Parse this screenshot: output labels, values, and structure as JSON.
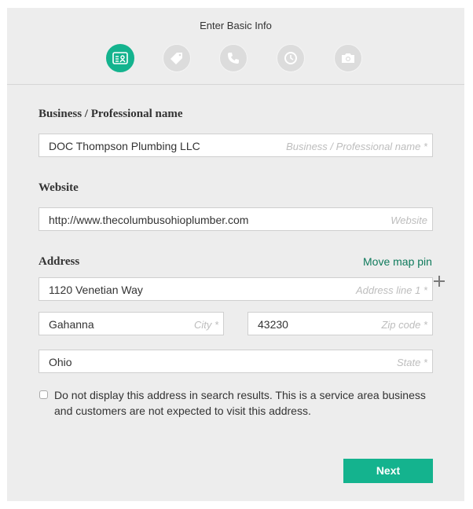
{
  "header": {
    "title": "Enter Basic Info",
    "steps": [
      {
        "icon": "id-card-icon",
        "active": true
      },
      {
        "icon": "tag-icon",
        "active": false
      },
      {
        "icon": "phone-icon",
        "active": false
      },
      {
        "icon": "clock-icon",
        "active": false
      },
      {
        "icon": "camera-icon",
        "active": false
      }
    ]
  },
  "form": {
    "business_name": {
      "label": "Business / Professional name",
      "value": "DOC Thompson Plumbing LLC",
      "placeholder": "Business / Professional name *"
    },
    "website": {
      "label": "Website",
      "value": "http://www.thecolumbusohioplumber.com",
      "placeholder": "Website"
    },
    "address": {
      "label": "Address",
      "move_pin_link": "Move map pin",
      "line1": {
        "value": "1120 Venetian Way",
        "placeholder": "Address line 1 *"
      },
      "city": {
        "value": "Gahanna",
        "placeholder": "City *"
      },
      "zip": {
        "value": "43230",
        "placeholder": "Zip code *"
      },
      "state": {
        "value": "Ohio",
        "placeholder": "State *"
      }
    },
    "hide_address": {
      "checked": false,
      "text": "Do not display this address in search results. This is a service area business and customers are not expected to visit this address."
    },
    "next_label": "Next"
  },
  "colors": {
    "accent": "#14b38e",
    "link": "#0f7a5c",
    "panel_bg": "#ededed",
    "inactive_step": "#dcdcdc"
  }
}
